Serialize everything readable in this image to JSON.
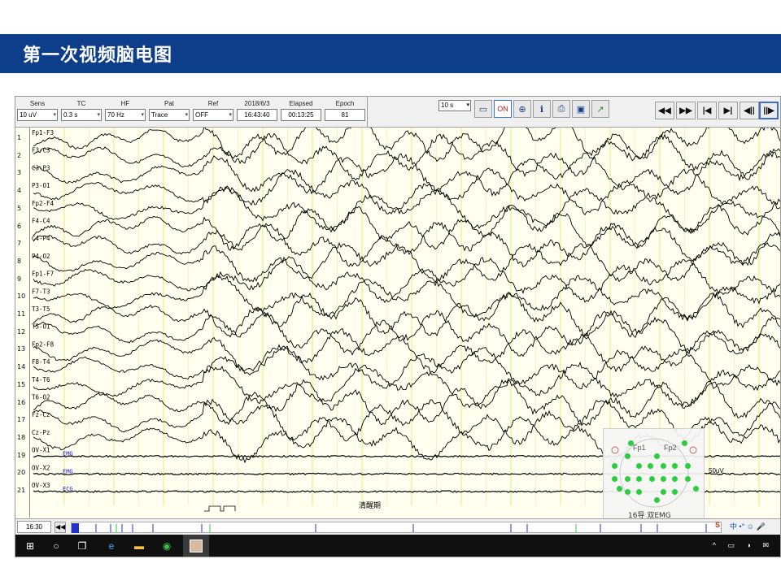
{
  "slide": {
    "title": "第一次视频脑电图"
  },
  "controls": {
    "sens": {
      "label": "Sens",
      "value": "10 uV"
    },
    "tc": {
      "label": "TC",
      "value": "0.3 s"
    },
    "hf": {
      "label": "HF",
      "value": "70 Hz"
    },
    "pat": {
      "label": "Pat",
      "value": "Trace"
    },
    "ref": {
      "label": "Ref",
      "value": "OFF"
    },
    "date": {
      "label": "2018/6/3",
      "value": "16:43:40"
    },
    "elapsed": {
      "label": "Elapsed",
      "value": "00:13:25"
    },
    "epoch": {
      "label": "Epoch",
      "value": "81"
    },
    "epoch_length": "10 s"
  },
  "toolbar_icons": [
    "save-icon",
    "montage-on-icon",
    "electrode-map-icon",
    "patient-info-icon",
    "print-icon",
    "photo-icon",
    "trend-icon"
  ],
  "nav_buttons": [
    "◀◀",
    "▶▶",
    "|◀",
    "▶|",
    "◀||",
    "||▶"
  ],
  "channels": [
    "Fp1-F3",
    "F3-C3",
    "C3-P3",
    "P3-O1",
    "Fp2-F4",
    "F4-C4",
    "C4-P4",
    "P4-O2",
    "Fp1-F7",
    "F7-T3",
    "T3-T5",
    "T5-O1",
    "Fp2-F8",
    "F8-T4",
    "T4-T6",
    "T6-O2",
    "Fz-Cz",
    "Cz-Pz",
    "OV-X1",
    "OV-X2",
    "OV-X3"
  ],
  "row_numbers": [
    "1",
    "2",
    "3",
    "4",
    "5",
    "6",
    "7",
    "8",
    "9",
    "10",
    "11",
    "12",
    "13",
    "14",
    "15",
    "16",
    "17",
    "18",
    "19",
    "20",
    "21"
  ],
  "aux_tags": {
    "emg1": "EMG",
    "emg2": "EMG",
    "ecg": "ECG"
  },
  "event_label": "清醒期",
  "scale": "50uV",
  "montage": {
    "caption": "16导 双EMG",
    "top_left": "Fp1",
    "top_right": "Fp2"
  },
  "status": {
    "time": "16:30"
  },
  "ime": {
    "brand": "S",
    "text": "中 •° ☺ 🎤"
  },
  "colors": {
    "title_bar": "#0e3e8a",
    "trace_bg": "#fffff0",
    "grid_line": "#e8e860",
    "trace": "#000000",
    "aux_tag": "#1a1acc"
  }
}
